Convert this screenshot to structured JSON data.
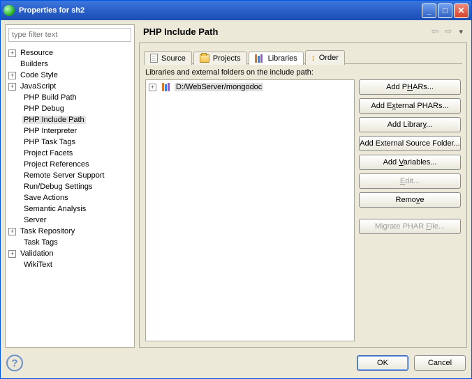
{
  "window": {
    "title": "Properties for sh2"
  },
  "filter": {
    "placeholder": "type filter text"
  },
  "tree": [
    {
      "label": "Resource",
      "expandable": true,
      "depth": 0
    },
    {
      "label": "Builders",
      "expandable": false,
      "depth": 0
    },
    {
      "label": "Code Style",
      "expandable": true,
      "depth": 0
    },
    {
      "label": "JavaScript",
      "expandable": true,
      "depth": 0
    },
    {
      "label": "PHP Build Path",
      "expandable": false,
      "depth": 1
    },
    {
      "label": "PHP Debug",
      "expandable": false,
      "depth": 1
    },
    {
      "label": "PHP Include Path",
      "expandable": false,
      "depth": 1,
      "selected": true
    },
    {
      "label": "PHP Interpreter",
      "expandable": false,
      "depth": 1
    },
    {
      "label": "PHP Task Tags",
      "expandable": false,
      "depth": 1
    },
    {
      "label": "Project Facets",
      "expandable": false,
      "depth": 1
    },
    {
      "label": "Project References",
      "expandable": false,
      "depth": 1
    },
    {
      "label": "Remote Server Support",
      "expandable": false,
      "depth": 1
    },
    {
      "label": "Run/Debug Settings",
      "expandable": false,
      "depth": 1
    },
    {
      "label": "Save Actions",
      "expandable": false,
      "depth": 1
    },
    {
      "label": "Semantic Analysis",
      "expandable": false,
      "depth": 1
    },
    {
      "label": "Server",
      "expandable": false,
      "depth": 1
    },
    {
      "label": "Task Repository",
      "expandable": true,
      "depth": 0
    },
    {
      "label": "Task Tags",
      "expandable": false,
      "depth": 1
    },
    {
      "label": "Validation",
      "expandable": true,
      "depth": 0
    },
    {
      "label": "WikiText",
      "expandable": false,
      "depth": 1
    }
  ],
  "header": {
    "title": "PHP Include Path"
  },
  "tabs": {
    "source": "Source",
    "projects": "Projects",
    "libraries": "Libraries",
    "order": "Order"
  },
  "libraries": {
    "desc": "Libraries and external folders on the include path:",
    "items": [
      {
        "path": "D:/WebServer/mongodoc"
      }
    ]
  },
  "buttons": {
    "add_phars": "Add PHARs...",
    "add_ext_phars": "Add External PHARs...",
    "add_library": "Add Library...",
    "add_ext_src": "Add External Source Folder...",
    "add_vars": "Add Variables...",
    "edit": "Edit...",
    "remove": "Remove",
    "migrate": "Migrate PHAR File..."
  },
  "footer": {
    "ok": "OK",
    "cancel": "Cancel"
  }
}
